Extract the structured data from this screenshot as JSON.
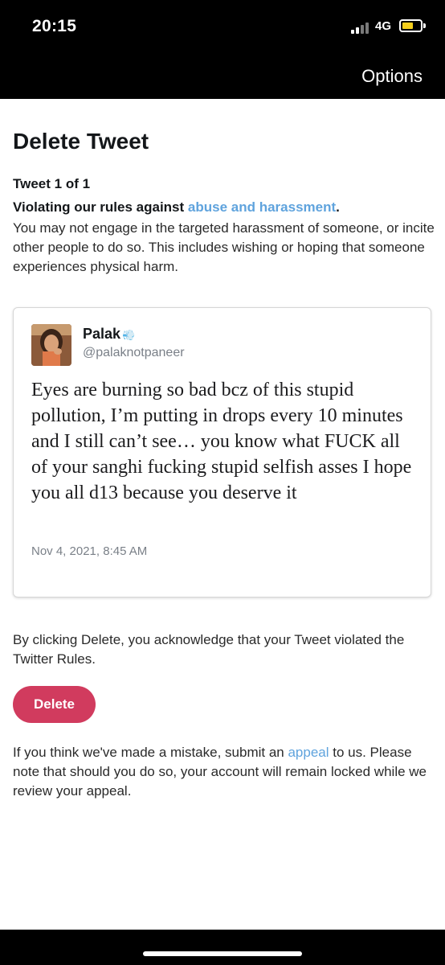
{
  "status_bar": {
    "time": "20:15",
    "network": "4G",
    "signal_icon": "signal-bars-icon",
    "battery_icon": "battery-icon",
    "battery_color": "#f5cf1c"
  },
  "nav": {
    "options_label": "Options"
  },
  "page": {
    "title": "Delete Tweet",
    "tweet_count": "Tweet 1 of 1",
    "rule_prefix": "Violating our rules against ",
    "rule_link": "abuse and harassment",
    "rule_suffix": ".",
    "rule_body": "You may not engage in the targeted harassment of someone, or incite other people to do so. This includes wishing or hoping that someone experiences physical harm."
  },
  "tweet": {
    "author_name": "Palak",
    "author_emoji": "💨",
    "handle": "@palaknotpaneer",
    "text": "Eyes are burning so bad bcz of this stupid pollution, I’m putting in drops every 10 minutes and I still can’t see… you know what FUCK all of your sanghi fucking stupid selfish asses I hope you all d13 because you deserve it",
    "date": "Nov 4, 2021, 8:45 AM"
  },
  "acknowledge": "By clicking Delete, you acknowledge that your Tweet violated the Twitter Rules.",
  "delete_button": {
    "label": "Delete",
    "color": "#d13b5e"
  },
  "appeal": {
    "prefix": "If you think we've made a mistake, submit an ",
    "link": "appeal",
    "suffix": " to us. Please note that should you do so, your account will remain locked while we review your appeal."
  },
  "colors": {
    "link": "#5fa3dd",
    "bars": "#000000"
  }
}
